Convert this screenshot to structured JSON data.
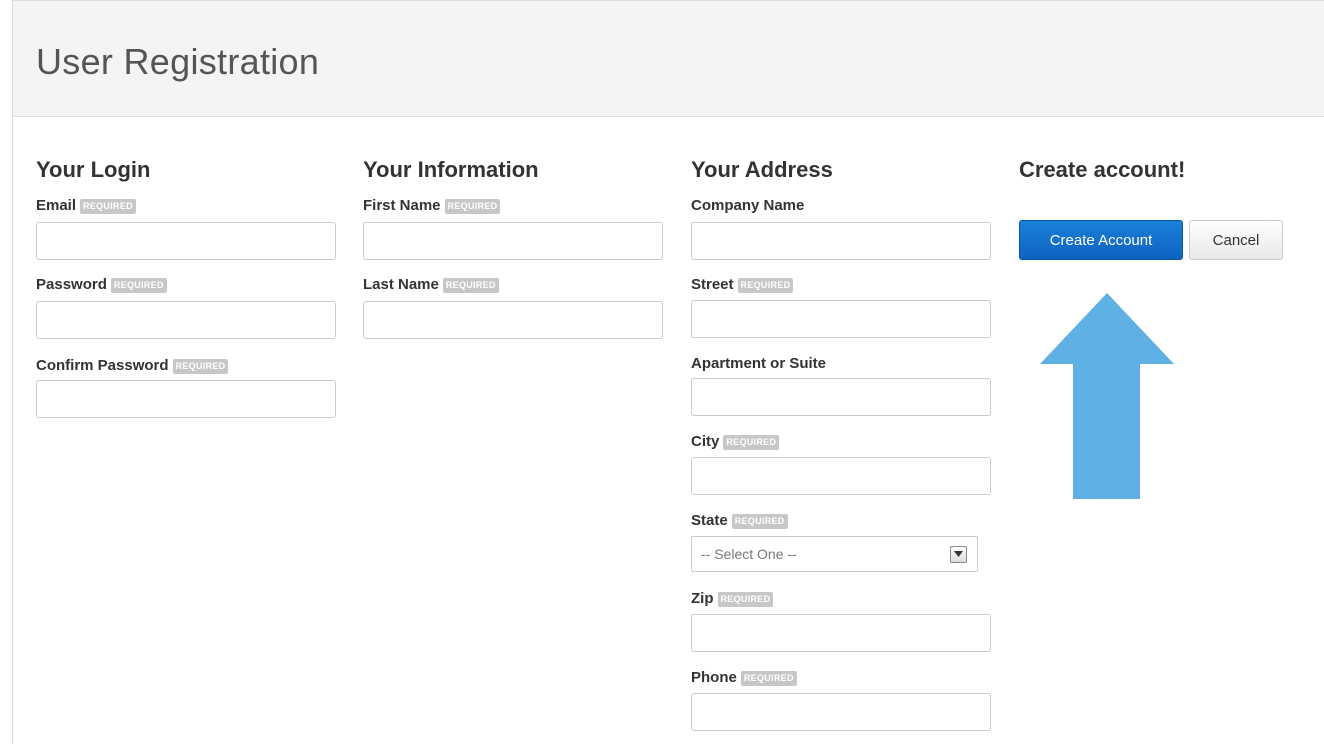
{
  "page": {
    "title": "User Registration",
    "required_tag": "REQUIRED"
  },
  "login": {
    "heading": "Your Login",
    "email_label": "Email",
    "password_label": "Password",
    "confirm_label": "Confirm Password"
  },
  "info": {
    "heading": "Your Information",
    "first_label": "First Name",
    "last_label": "Last Name"
  },
  "address": {
    "heading": "Your Address",
    "company_label": "Company Name",
    "street_label": "Street",
    "apt_label": "Apartment or Suite",
    "city_label": "City",
    "state_label": "State",
    "state_value": "-- Select One --",
    "zip_label": "Zip",
    "phone_label": "Phone"
  },
  "create": {
    "heading": "Create account!",
    "create_button": "Create Account",
    "cancel_button": "Cancel"
  },
  "colors": {
    "primary": "#0e63c0",
    "arrow": "#5fb0e4",
    "required_badge": "#c7c7c7"
  },
  "icons": {
    "select_arrow": "chevron-down-icon",
    "pointer": "up-arrow-icon"
  }
}
